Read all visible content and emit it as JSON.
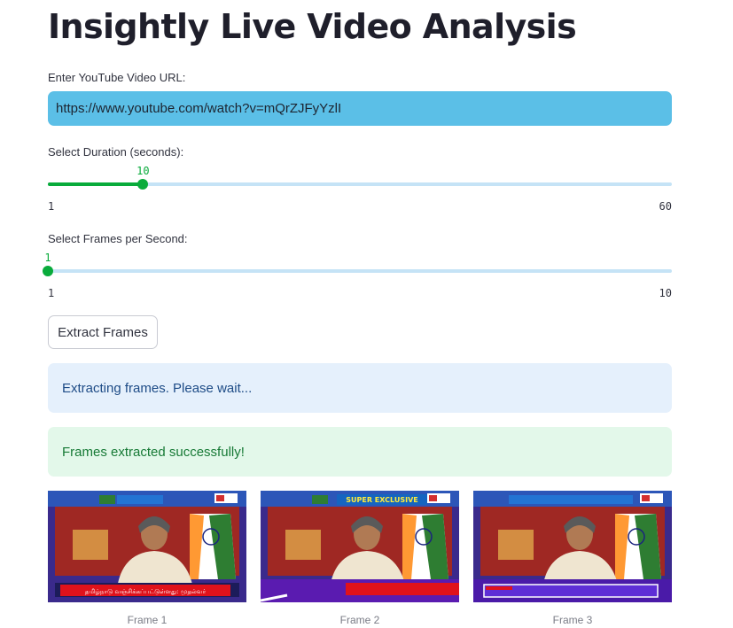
{
  "page": {
    "title": "Insightly Live Video Analysis"
  },
  "url_field": {
    "label": "Enter YouTube Video URL:",
    "value": "https://www.youtube.com/watch?v=mQrZJFyYzlI"
  },
  "duration_slider": {
    "label": "Select Duration (seconds):",
    "value": 10,
    "min": 1,
    "max": 60
  },
  "fps_slider": {
    "label": "Select Frames per Second:",
    "value": 1,
    "min": 1,
    "max": 10
  },
  "extract_button": {
    "label": "Extract Frames"
  },
  "alerts": {
    "info": "Extracting frames. Please wait...",
    "success": "Frames extracted successfully!"
  },
  "frames": [
    {
      "caption": "Frame 1",
      "ticker_text": "தமிழ்நாடு வஞ்சிக்கப்பட்டுள்ளது: முதல்வர்",
      "banner_text": ""
    },
    {
      "caption": "Frame 2",
      "ticker_text": "",
      "banner_text": "SUPER EXCLUSIVE"
    },
    {
      "caption": "Frame 3",
      "ticker_text": "",
      "banner_text": ""
    }
  ],
  "colors": {
    "accent": "#09ab3b",
    "track": "#c5e3f6",
    "url_bg": "#5bbfe7"
  }
}
